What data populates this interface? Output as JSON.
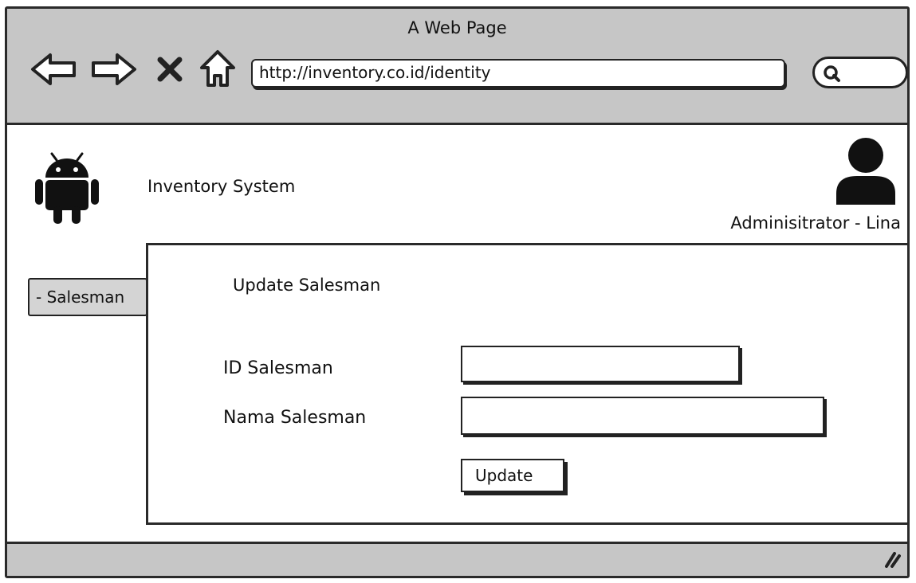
{
  "browser": {
    "title": "A Web Page",
    "url": "http://inventory.co.id/identity",
    "icons": [
      "back-arrow-icon",
      "forward-arrow-icon",
      "close-icon",
      "home-icon",
      "search-icon"
    ]
  },
  "header": {
    "app_name": "Inventory System",
    "user_label": "Adminisitrator - Lina",
    "logo_icon": "android-icon",
    "avatar_icon": "user-icon"
  },
  "sidebar": {
    "items": [
      {
        "label": "- Salesman"
      }
    ]
  },
  "form": {
    "title": "Update Salesman",
    "fields": [
      {
        "label": "ID Salesman",
        "value": ""
      },
      {
        "label": "Nama Salesman",
        "value": ""
      }
    ],
    "submit_label": "Update"
  },
  "colors": {
    "chrome": "#c6c6c6",
    "border": "#2a2a2a",
    "sidebar_button": "#d4d4d4"
  }
}
